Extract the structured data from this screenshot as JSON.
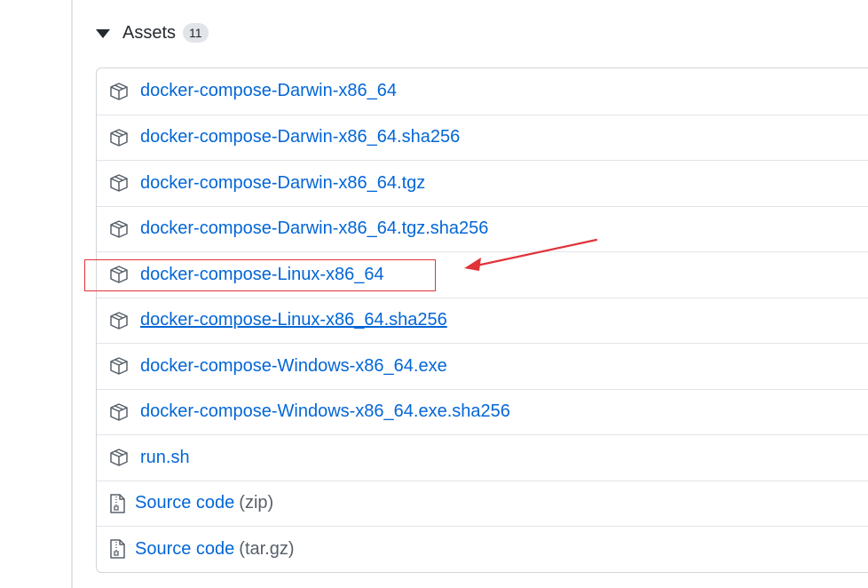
{
  "assets_header": {
    "title": "Assets",
    "count": "11"
  },
  "assets": [
    {
      "name": "docker-compose-Darwin-x86_64",
      "icon": "package-icon"
    },
    {
      "name": "docker-compose-Darwin-x86_64.sha256",
      "icon": "package-icon"
    },
    {
      "name": "docker-compose-Darwin-x86_64.tgz",
      "icon": "package-icon"
    },
    {
      "name": "docker-compose-Darwin-x86_64.tgz.sha256",
      "icon": "package-icon"
    },
    {
      "name": "docker-compose-Linux-x86_64",
      "icon": "package-icon",
      "highlighted": true
    },
    {
      "name": "docker-compose-Linux-x86_64.sha256",
      "icon": "package-icon",
      "hovered": true
    },
    {
      "name": "docker-compose-Windows-x86_64.exe",
      "icon": "package-icon"
    },
    {
      "name": "docker-compose-Windows-x86_64.exe.sha256",
      "icon": "package-icon"
    },
    {
      "name": "run.sh",
      "icon": "package-icon"
    }
  ],
  "source_code": [
    {
      "label": "Source code",
      "suffix": "(zip)",
      "icon": "file-zip-icon"
    },
    {
      "label": "Source code",
      "suffix": "(tar.gz)",
      "icon": "file-zip-icon"
    }
  ],
  "colors": {
    "link": "#0366d6",
    "annotation": "#e0333a",
    "border": "#d1d5da"
  }
}
